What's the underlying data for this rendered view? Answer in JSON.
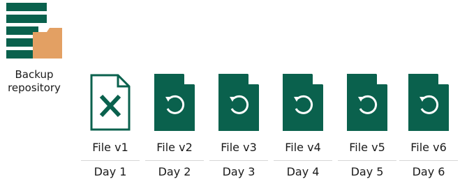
{
  "repository": {
    "label": "Backup\nrepository",
    "icon": "backup-repository-icon"
  },
  "colors": {
    "green": "#0a614d",
    "orange": "#e3a063",
    "separator": "#d6d6d6"
  },
  "files": [
    {
      "name": "File v1",
      "day": "Day 1",
      "status": "corrupted",
      "icon": "corrupted-file-icon"
    },
    {
      "name": "File v2",
      "day": "Day 2",
      "status": "restore",
      "icon": "restore-file-icon"
    },
    {
      "name": "File v3",
      "day": "Day 3",
      "status": "restore",
      "icon": "restore-file-icon"
    },
    {
      "name": "File v4",
      "day": "Day 4",
      "status": "restore",
      "icon": "restore-file-icon"
    },
    {
      "name": "File v5",
      "day": "Day 5",
      "status": "restore",
      "icon": "restore-file-icon"
    },
    {
      "name": "File v6",
      "day": "Day 6",
      "status": "restore",
      "icon": "restore-file-icon"
    }
  ]
}
